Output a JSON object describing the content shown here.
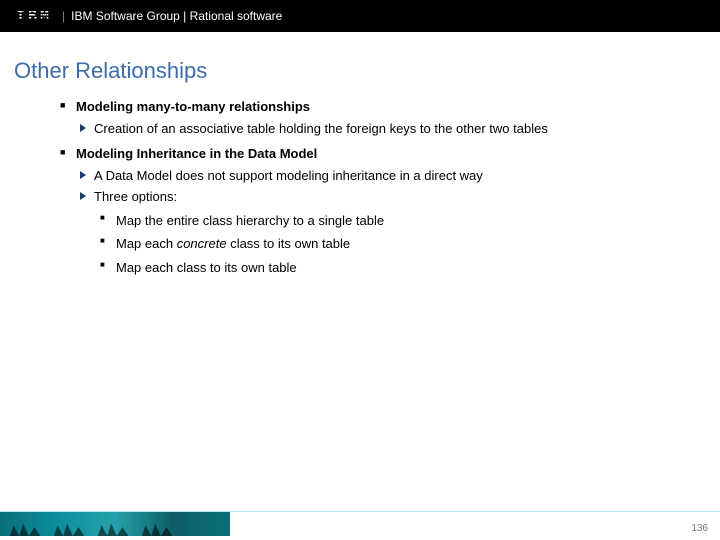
{
  "header": {
    "logo_text": "IBM",
    "group_text": "IBM Software Group | Rational software"
  },
  "title": "Other Relationships",
  "sections": [
    {
      "heading": "Modeling many-to-many relationships",
      "items": [
        {
          "text": "Creation of an associative table holding the foreign keys to the other two tables"
        }
      ]
    },
    {
      "heading": "Modeling Inheritance in the Data Model",
      "items": [
        {
          "text": "A Data Model does not support modeling inheritance in a direct way"
        },
        {
          "text": "Three options:",
          "sub": [
            {
              "text": "Map the entire class hierarchy to a single table"
            },
            {
              "pre": "Map each ",
              "em": "concrete",
              "post": " class to its own table"
            },
            {
              "text": "Map each class to its own table"
            }
          ]
        }
      ]
    }
  ],
  "page_number": "136"
}
